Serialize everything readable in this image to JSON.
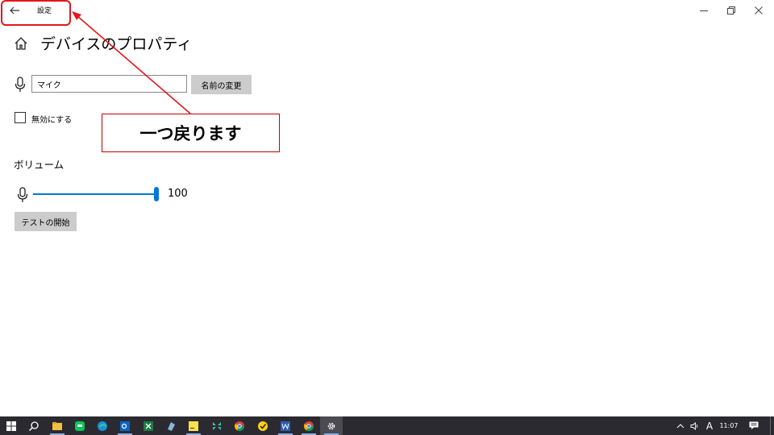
{
  "window": {
    "title": "設定",
    "controls": {
      "minimize_icon": "minimize-icon",
      "maximize_icon": "restore-icon",
      "close_icon": "close-icon"
    }
  },
  "header": {
    "title": "デバイスのプロパティ",
    "home_icon": "home-icon"
  },
  "device_name": {
    "value": "マイク",
    "rename_label": "名前の変更"
  },
  "disable": {
    "label": "無効にする",
    "checked": false
  },
  "volume": {
    "heading": "ボリューム",
    "value": "100",
    "level_percent": 100
  },
  "test": {
    "label": "テストの開始"
  },
  "annotation": {
    "text": "一つ戻ります",
    "color": "#e3161b"
  },
  "taskbar": {
    "items": [
      "windows-start-icon",
      "search-icon",
      "file-explorer-icon",
      "line-icon",
      "edge-icon",
      "outlook-icon",
      "excel-icon",
      "notepad-icon",
      "sticky-notes-icon",
      "app-grid-icon",
      "chrome-icon",
      "norton-icon",
      "word-icon",
      "chrome-alt-icon",
      "settings-icon"
    ],
    "tray": {
      "ime": "A",
      "time": "11:07"
    }
  },
  "colors": {
    "accent": "#0078d7",
    "button_bg": "#cccccc",
    "taskbar_bg": "#2b2a31"
  }
}
